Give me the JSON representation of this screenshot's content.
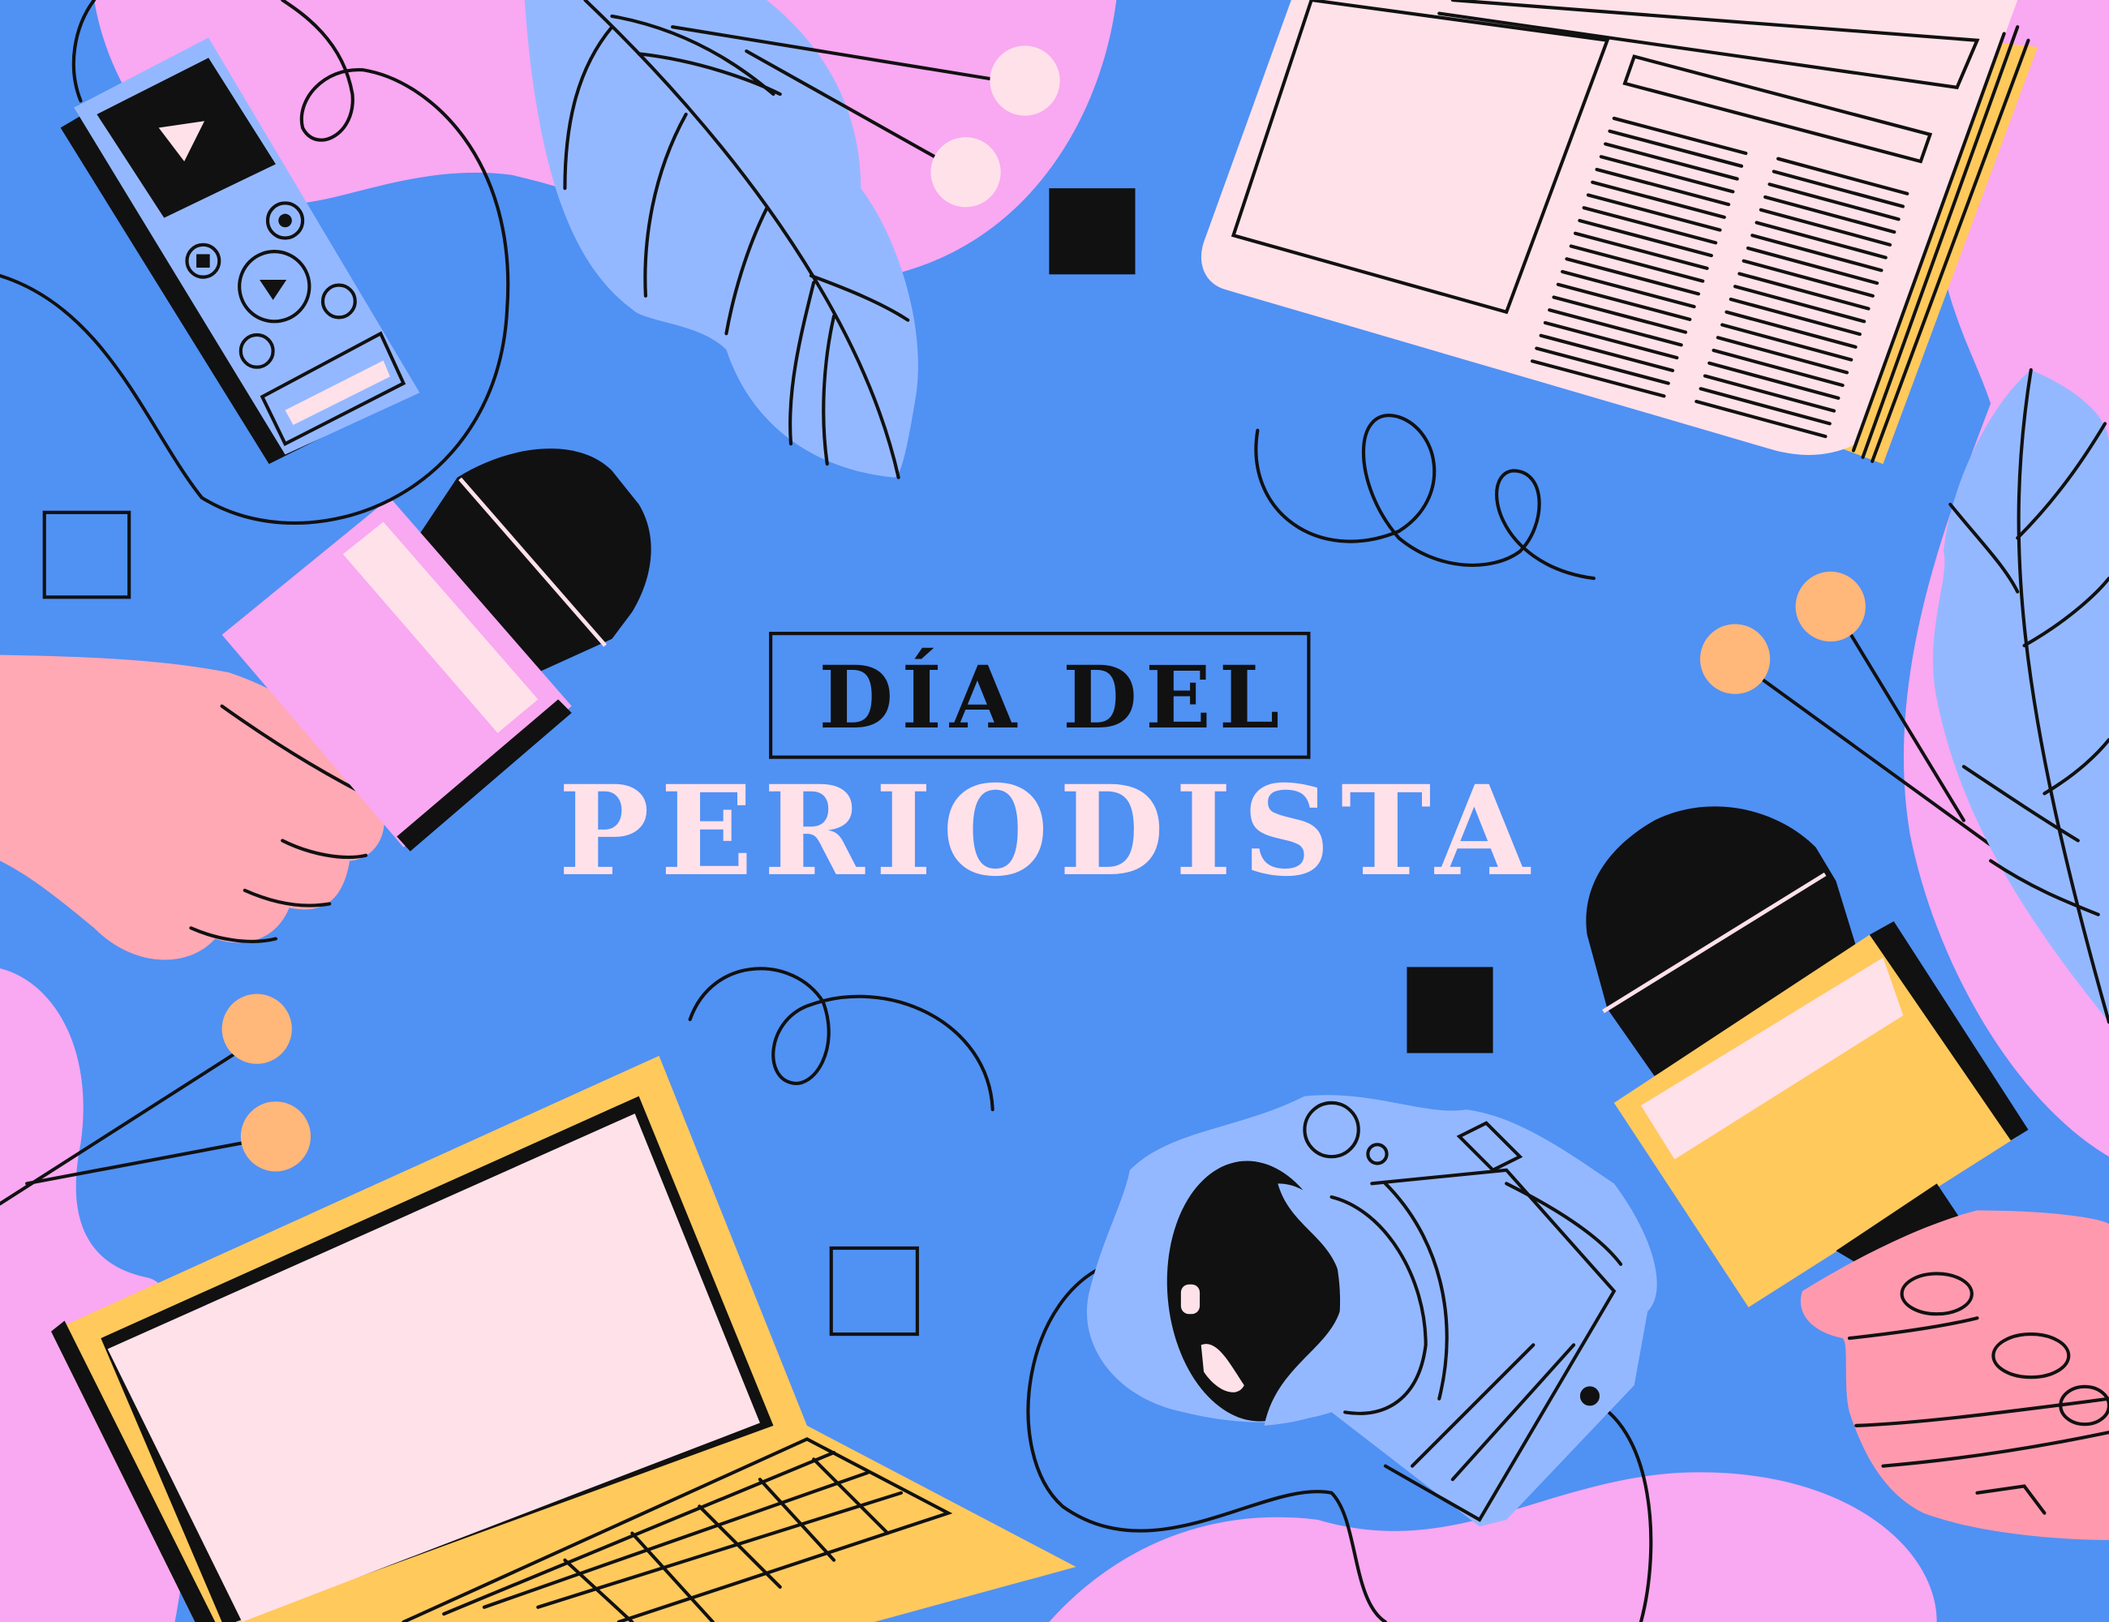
{
  "title": {
    "line1": "DÍA DEL",
    "line2": "PERIODISTA"
  },
  "colors": {
    "background": "#5091f4",
    "pink_blob": "#f9a8f2",
    "light_blue": "#94b8ff",
    "paper": "#ffe1ea",
    "yellow": "#ffc95c",
    "orange_dot": "#ffb77a",
    "hand": "#ffa5b3",
    "ink": "#111111"
  },
  "icons": [
    "voice-recorder-icon",
    "microphone-icon",
    "newspaper-icon",
    "laptop-icon",
    "camera-icon",
    "leaf-icon",
    "hand-icon"
  ]
}
